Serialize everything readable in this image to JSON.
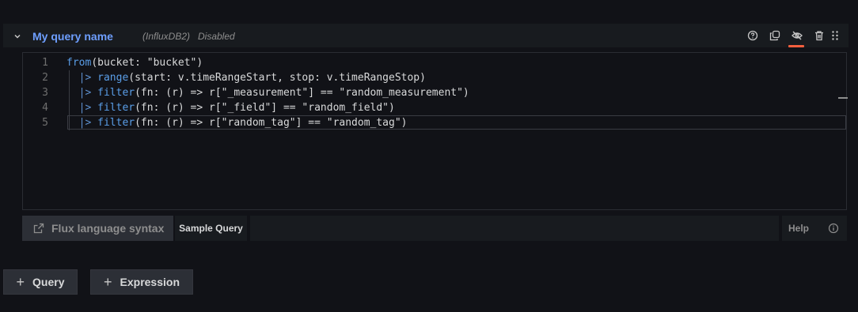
{
  "query": {
    "name": "My query name",
    "datasource": "(InfluxDB2)",
    "status": "Disabled",
    "icons": [
      "help-icon",
      "duplicate-icon",
      "eye-off-icon",
      "trash-icon",
      "drag-icon"
    ],
    "accent_color": "#f55f3e"
  },
  "editor": {
    "lines": [
      {
        "num": "1",
        "parts": [
          [
            "fn",
            "from"
          ],
          [
            "txt",
            "(bucket: \"bucket\")"
          ]
        ]
      },
      {
        "num": "2",
        "parts": [
          [
            "txt",
            "  "
          ],
          [
            "pipe",
            "|>"
          ],
          [
            "txt",
            " "
          ],
          [
            "fn",
            "range"
          ],
          [
            "txt",
            "(start: v.timeRangeStart, stop: v.timeRangeStop)"
          ]
        ]
      },
      {
        "num": "3",
        "parts": [
          [
            "txt",
            "  "
          ],
          [
            "pipe",
            "|>"
          ],
          [
            "txt",
            " "
          ],
          [
            "fn",
            "filter"
          ],
          [
            "txt",
            "(fn: (r) => r[\"_measurement\"] == \"random_measurement\")"
          ]
        ]
      },
      {
        "num": "4",
        "parts": [
          [
            "txt",
            "  "
          ],
          [
            "pipe",
            "|>"
          ],
          [
            "txt",
            " "
          ],
          [
            "fn",
            "filter"
          ],
          [
            "txt",
            "(fn: (r) => r[\"_field\"] == \"random_field\")"
          ]
        ]
      },
      {
        "num": "5",
        "parts": [
          [
            "txt",
            "  "
          ],
          [
            "pipe",
            "|>"
          ],
          [
            "txt",
            " "
          ],
          [
            "fn",
            "filter"
          ],
          [
            "txt",
            "(fn: (r) => r[\"random_tag\"] == \"random_tag\")"
          ]
        ]
      }
    ]
  },
  "footer": {
    "flux_link_label": "Flux language syntax",
    "sample_query_label": "Sample Query",
    "sample_query_value": "",
    "help_label": "Help"
  },
  "actions": {
    "add_query_label": "Query",
    "add_expression_label": "Expression"
  }
}
